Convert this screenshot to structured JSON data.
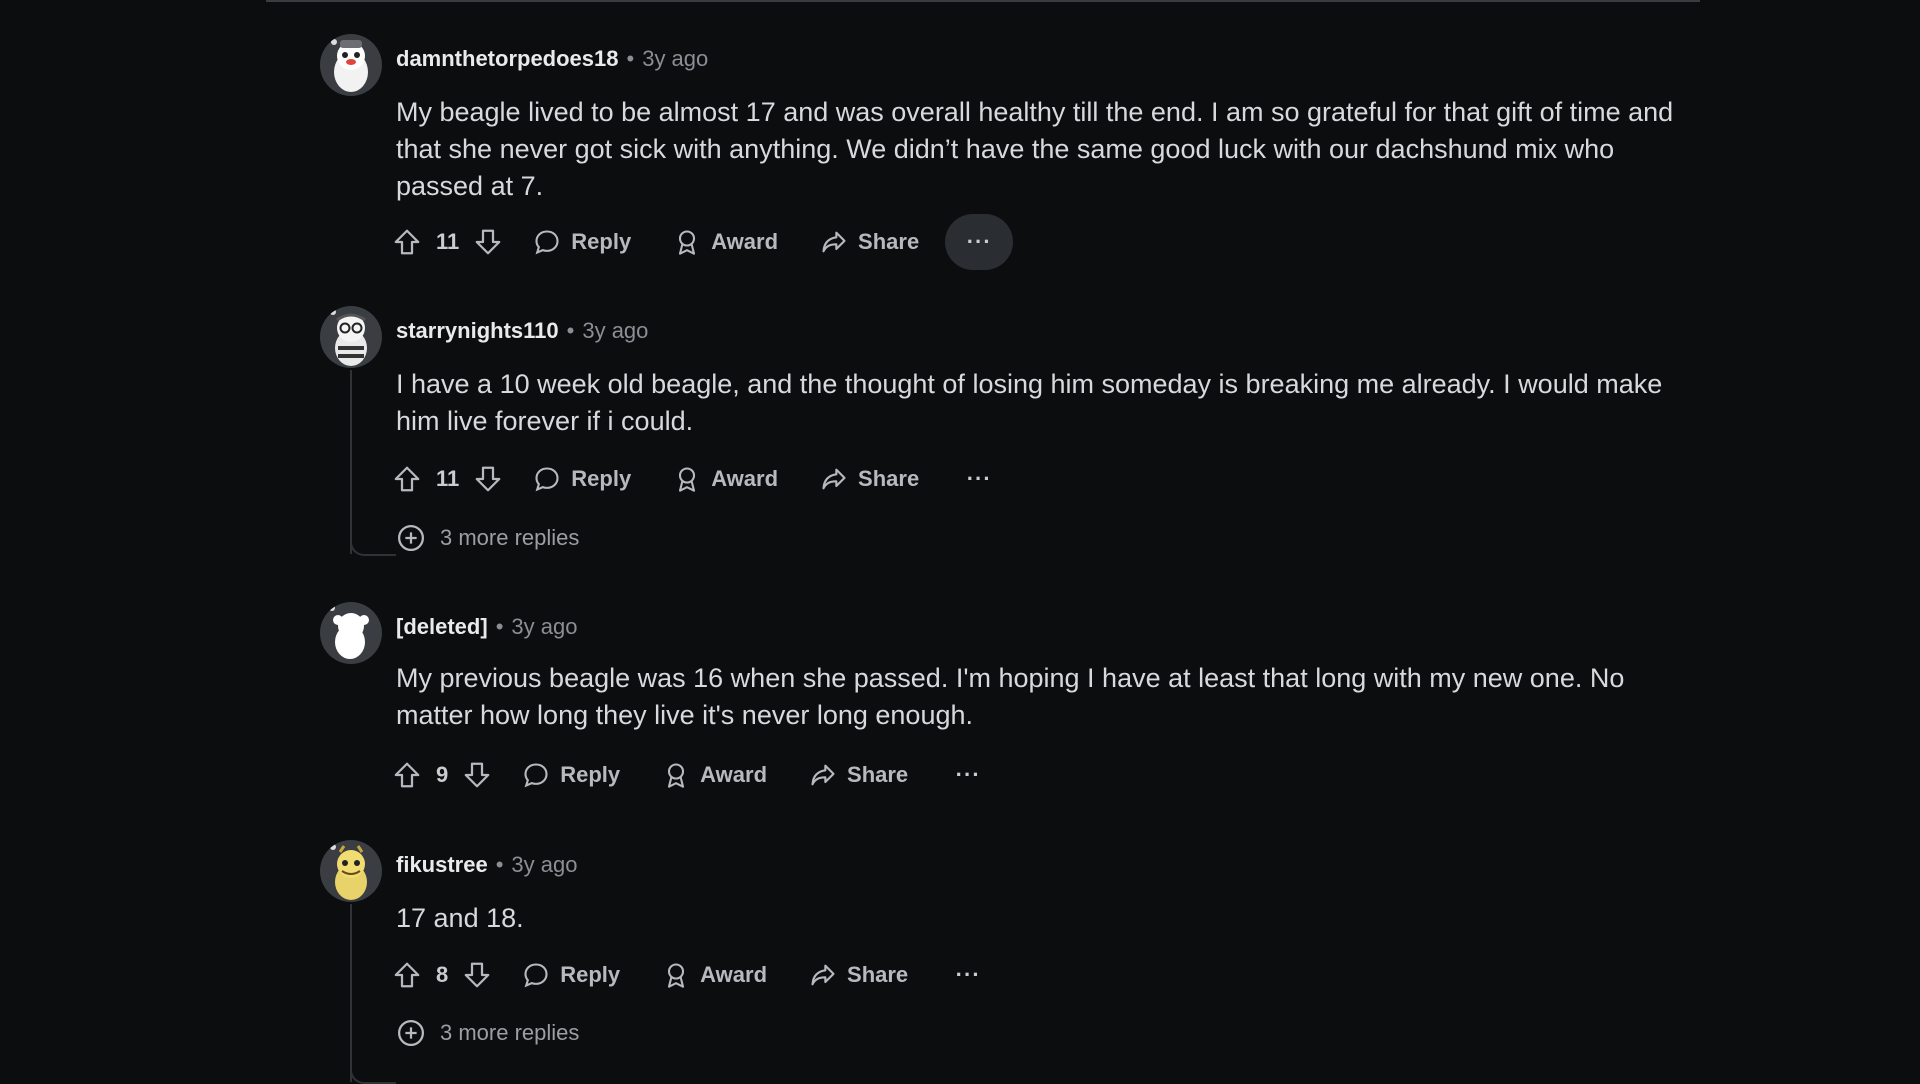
{
  "comments": [
    {
      "username": "damnthetorpedoes18",
      "time": "3y ago",
      "body": "My beagle lived to be almost 17 and was overall healthy till the end. I am so grateful for that gift of time and that she never got sick with anything. We didn’t have the same good luck with our dachshund mix who passed at 7.",
      "votes": "11",
      "reply": "Reply",
      "award": "Award",
      "share": "Share",
      "more": "···"
    },
    {
      "username": "starrynights110",
      "time": "3y ago",
      "body": "I have a 10 week old beagle, and the thought of losing him someday is breaking me already. I would make him live forever if i could.",
      "votes": "11",
      "reply": "Reply",
      "award": "Award",
      "share": "Share",
      "more": "···",
      "more_replies": "3 more replies"
    },
    {
      "username": "[deleted]",
      "time": "3y ago",
      "body": "My previous beagle was 16 when she passed. I'm hoping I have at least that long with my new one. No matter how long they live it's never long enough.",
      "votes": "9",
      "reply": "Reply",
      "award": "Award",
      "share": "Share",
      "more": "···"
    },
    {
      "username": "fikustree",
      "time": "3y ago",
      "body": "17 and 18.",
      "votes": "8",
      "reply": "Reply",
      "award": "Award",
      "share": "Share",
      "more": "···",
      "more_replies": "3 more replies"
    }
  ],
  "separator": "•",
  "colors": {
    "background": "#0b0d0f",
    "text": "#d7dadc",
    "meta": "#8a8f94",
    "thread_line": "#2f3336",
    "active_button": "#2a2e33"
  },
  "icons": [
    "upvote-icon",
    "downvote-icon",
    "reply-icon",
    "award-icon",
    "share-icon",
    "expand-plus-icon",
    "avatar-snoo-icon"
  ]
}
